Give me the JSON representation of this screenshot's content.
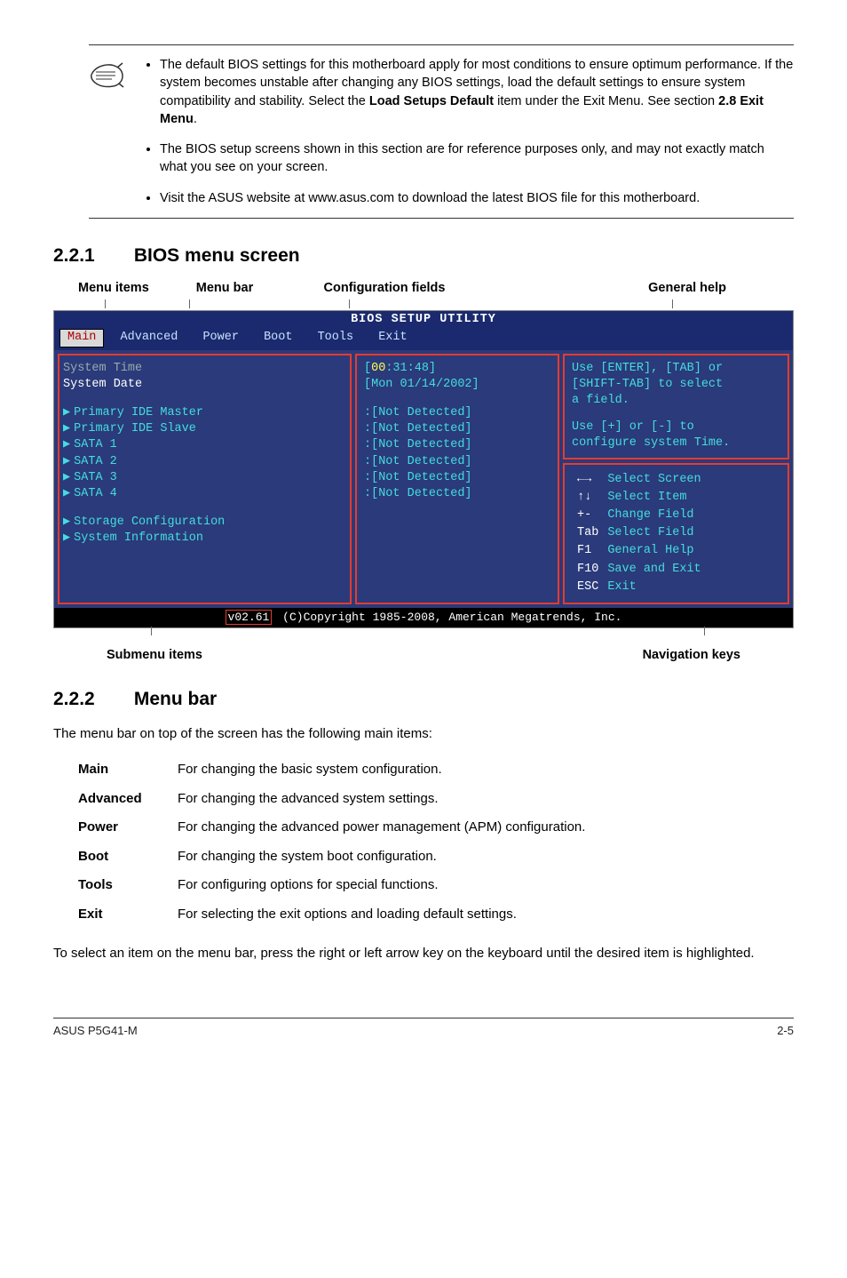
{
  "notes": [
    "The default BIOS settings for this motherboard apply for most conditions to ensure optimum performance. If the system becomes unstable after changing any BIOS settings, load the default settings to ensure system compatibility and stability. Select the <b>Load Setups Default</b> item under the Exit Menu. See section <b>2.8 Exit Menu</b>.",
    "The BIOS setup screens shown in this section are for reference purposes only, and may not exactly match what you see on your screen.",
    "Visit the ASUS website at www.asus.com to download the latest BIOS file for this motherboard."
  ],
  "section1": {
    "num": "2.2.1",
    "title": "BIOS menu screen"
  },
  "top_labels": {
    "menu_items": "Menu items",
    "menu_bar": "Menu bar",
    "config_fields": "Configuration fields",
    "general_help": "General help"
  },
  "bios": {
    "title": "BIOS SETUP UTILITY",
    "tabs": [
      "Main",
      "Advanced",
      "Power",
      "Boot",
      "Tools",
      "Exit"
    ],
    "left": {
      "system_time_label": "System Time",
      "system_date_label": "System Date",
      "items": [
        "Primary IDE Master",
        "Primary IDE Slave",
        "SATA 1",
        "SATA 2",
        "SATA 3",
        "SATA 4"
      ],
      "storage": "Storage Configuration",
      "sysinfo": "System Information"
    },
    "mid": {
      "time_prefix": "[",
      "time_hh": "00",
      "time_rest": ":31:48]",
      "date": "[Mon 01/14/2002]",
      "detect": ":[Not Detected]"
    },
    "help1": {
      "l1": "Use [ENTER], [TAB] or",
      "l2": "[SHIFT-TAB] to select",
      "l3": "a field.",
      "l4": "Use [+] or [-] to",
      "l5": "configure system Time."
    },
    "nav": [
      {
        "k": "←→",
        "v": "Select Screen"
      },
      {
        "k": "↑↓",
        "v": "Select Item"
      },
      {
        "k": "+-",
        "v": "Change Field"
      },
      {
        "k": "Tab",
        "v": "Select Field"
      },
      {
        "k": "F1",
        "v": "General Help"
      },
      {
        "k": "F10",
        "v": "Save and Exit"
      },
      {
        "k": "ESC",
        "v": "Exit"
      }
    ],
    "footer_ver": "v02.61",
    "footer_text": "(C)Copyright 1985-2008, American Megatrends, Inc."
  },
  "bottom_labels": {
    "submenu": "Submenu items",
    "navkeys": "Navigation keys"
  },
  "section2": {
    "num": "2.2.2",
    "title": "Menu bar"
  },
  "menubar_intro": "The menu bar on top of the screen has the following main items:",
  "menubar_items": [
    {
      "key": "Main",
      "desc": "For changing the basic system configuration."
    },
    {
      "key": "Advanced",
      "desc": "For changing the advanced system settings."
    },
    {
      "key": "Power",
      "desc": "For changing the advanced power management (APM) configuration."
    },
    {
      "key": "Boot",
      "desc": "For changing the system boot configuration."
    },
    {
      "key": "Tools",
      "desc": "For configuring options for special functions."
    },
    {
      "key": "Exit",
      "desc": "For selecting the exit options and loading default settings."
    }
  ],
  "menubar_outro": "To select an item on the menu bar, press the right or left arrow key on the keyboard until the desired item is highlighted.",
  "footer": {
    "left": "ASUS P5G41-M",
    "right": "2-5"
  }
}
